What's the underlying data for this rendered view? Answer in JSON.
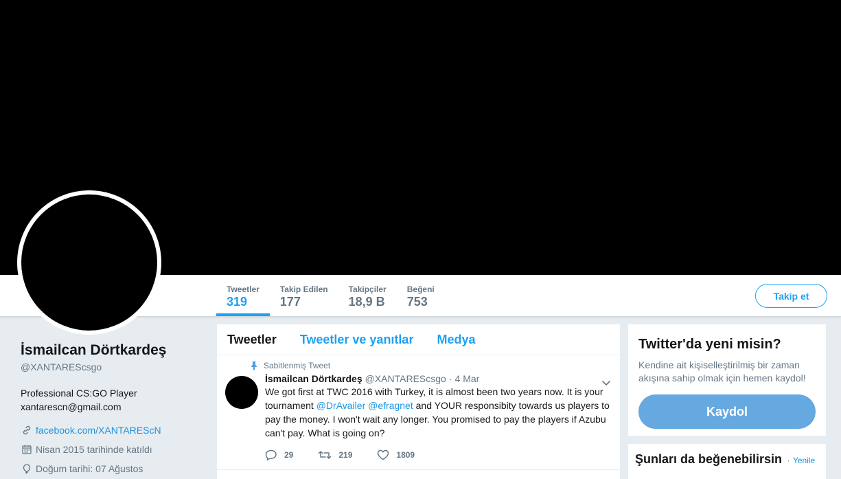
{
  "profile": {
    "name": "İsmailcan Dörtkardeş",
    "handle": "@XANTAREScsgo",
    "bio_line1": "Professional CS:GO Player",
    "bio_line2": "xantarescn@gmail.com",
    "website": "facebook.com/XANTAREScN",
    "joined": "Nisan 2015 tarihinde katıldı",
    "birthday": "Doğum tarihi: 07 Ağustos"
  },
  "stats": [
    {
      "label": "Tweetler",
      "value": "319"
    },
    {
      "label": "Takip Edilen",
      "value": "177"
    },
    {
      "label": "Takipçiler",
      "value": "18,9 B"
    },
    {
      "label": "Beğeni",
      "value": "753"
    }
  ],
  "follow_button": "Takip et",
  "timeline": {
    "tabs": [
      "Tweetler",
      "Tweetler ve yanıtlar",
      "Medya"
    ],
    "pinned_label": "Sabitlenmiş Tweet",
    "tweet": {
      "name": "İsmailcan Dörtkardeş",
      "handle": "@XANTAREScsgo",
      "dot": "·",
      "time": "4 Mar",
      "text_part1": "We got first at TWC 2016 with Turkey, it is almost been two years now. It is your tournament ",
      "mention1": "@DrAvailer",
      "text_space": " ",
      "mention2": "@efragnet",
      "text_part2": " and YOUR responsibity towards us players to pay the money. I won't wait any longer. You promised to pay the players if Azubu can't pay. What is going on?",
      "replies": "29",
      "retweets": "219",
      "likes": "1809"
    }
  },
  "signup": {
    "title": "Twitter'da yeni misin?",
    "text": "Kendine ait kişiselleştirilmiş bir zaman akışına sahip olmak için hemen kaydol!",
    "button": "Kaydol"
  },
  "suggestions": {
    "title": "Şunları da beğenebilirsin",
    "dot": "·",
    "refresh": "Yenile"
  },
  "colors": {
    "accent": "#1da1f2",
    "link": "#1b95e0",
    "signup_button": "#66a9e0",
    "background": "#e6ecf0"
  }
}
